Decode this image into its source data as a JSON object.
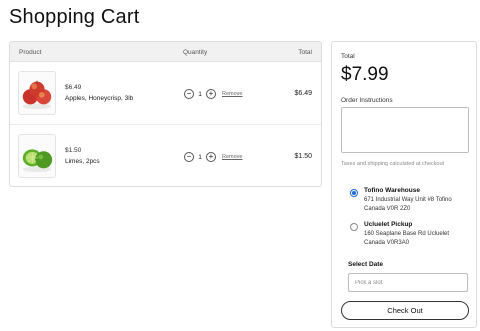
{
  "page": {
    "title": "Shopping Cart"
  },
  "cart": {
    "columns": {
      "product": "Product",
      "quantity": "Quantity",
      "total": "Total"
    },
    "items": [
      {
        "price": "$6.49",
        "name": "Apples, Honeycrisp, 3lb",
        "quantity": "1",
        "remove_label": "Remove",
        "line_total": "$6.49",
        "image_icon": "apples-image"
      },
      {
        "price": "$1.50",
        "name": "Limes, 2pcs",
        "quantity": "1",
        "remove_label": "Remove",
        "line_total": "$1.50",
        "image_icon": "limes-image"
      }
    ],
    "minus_glyph": "−",
    "plus_glyph": "+"
  },
  "summary": {
    "total_label": "Total",
    "total_value": "$7.99",
    "instructions_label": "Order Instructions",
    "instructions_value": "",
    "shipping_note": "Taxes and shipping calculated at checkout",
    "pickup_options": [
      {
        "name": "Tofino Warehouse",
        "address_line1": "671 Industrial Way Unit #8 Tofino",
        "address_line2": "Canada V0R 2Z0",
        "selected": true
      },
      {
        "name": "Ucluelet Pickup",
        "address_line1": "160 Seaplane Base Rd Ucluelet",
        "address_line2": "Canada V0R3A0",
        "selected": false
      }
    ],
    "date_label": "Select Date",
    "date_placeholder": "Pick a slot",
    "checkout_label": "Check Out"
  },
  "colors": {
    "accent": "#1e6bd6",
    "border": "#dcdcdc",
    "header_bg": "#f1f1f1"
  }
}
